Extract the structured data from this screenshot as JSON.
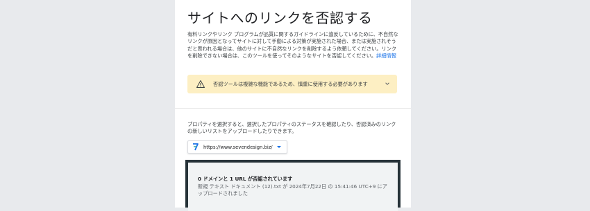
{
  "page": {
    "title": "サイトへのリンクを否認する",
    "description": "有料リンクやリンク プログラムが品質に関するガイドラインに違反しているために、不自然なリンクが原因となってサイトに対して手動による対策が実施された場合、または実施されそうだと思われる場合は、他のサイトに不自然なリンクを削除するよう依頼してください。リンクを削除できない場合は、このツールを使ってそのようなサイトを否認してください。",
    "details_link": "詳細情報"
  },
  "warning": {
    "text": "否認ツールは複雑な機能であるため、慎重に使用する必要があります",
    "icon": "warning-triangle-icon"
  },
  "property_section": {
    "description": "プロパティを選択すると、選択したプロパティのステータスを確認したり、否認済みのリンクの新しいリストをアップロードしたりできます。",
    "selected_property": "https://www.sevendesign.biz/"
  },
  "status": {
    "main": "0 ドメインと 1 URL が否認されています",
    "sub": "新規 テキスト ドキュメント (12).txt が 2024年7月22日 の 15:41:46 UTC+9 にアップロードされました"
  },
  "colors": {
    "accent": "#1a73e8",
    "warning_bg": "#fdefc3",
    "frame": "#263238"
  }
}
